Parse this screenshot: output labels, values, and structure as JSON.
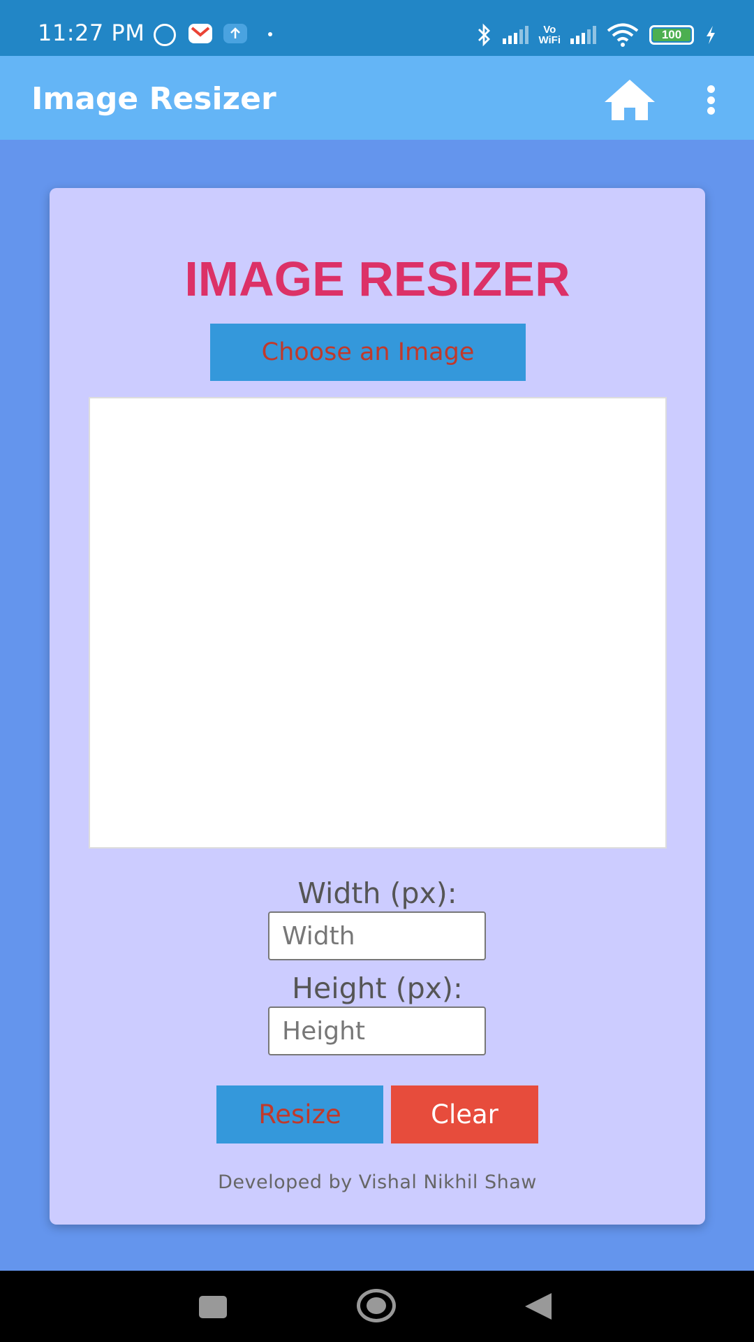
{
  "status_bar": {
    "time": "11:27 PM",
    "notification_icons": [
      "telegram-icon",
      "gmail-icon",
      "upload-icon"
    ],
    "vowifi_label": "Vo\nWiFi",
    "battery_level": "100",
    "background_color": "#2286C6"
  },
  "app_bar": {
    "title": "Image Resizer",
    "home_icon": "home-icon",
    "menu_icon": "more-vert-icon",
    "background_color": "#64B5F6"
  },
  "main": {
    "heading": "IMAGE RESIZER",
    "choose_button": "Choose an Image",
    "width_label": "Width (px):",
    "width_placeholder": "Width",
    "width_value": "",
    "height_label": "Height (px):",
    "height_placeholder": "Height",
    "height_value": "",
    "resize_button": "Resize",
    "clear_button": "Clear",
    "footer": "Developed by Vishal Nikhil Shaw",
    "colors": {
      "page_background": "#6495ED",
      "card_background": "#CCCCFF",
      "heading": "#DC3167",
      "primary_button": "#3498DB",
      "primary_button_text": "#C0392B",
      "clear_button": "#E74C3C"
    }
  },
  "nav_bar": {
    "items": [
      "recents-icon",
      "home-circle-icon",
      "back-icon"
    ]
  }
}
